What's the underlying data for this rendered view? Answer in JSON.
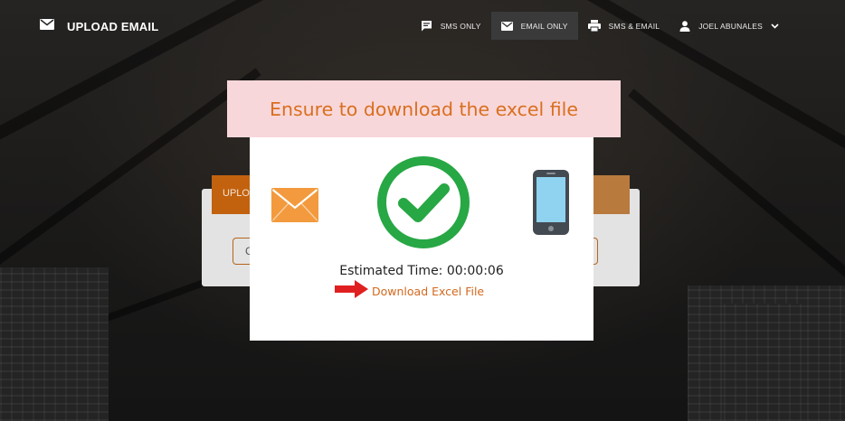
{
  "header": {
    "title": "UPLOAD EMAIL",
    "title_icon": "envelope-icon"
  },
  "nav": {
    "items": [
      {
        "label": "SMS ONLY",
        "icon": "sms-icon"
      },
      {
        "label": "EMAIL ONLY",
        "icon": "envelope-icon",
        "active": true
      },
      {
        "label": "SMS & EMAIL",
        "icon": "printer-icon"
      },
      {
        "label": "JOEL ABUNALES",
        "icon": "user-icon",
        "dropdown": "chevron-down-icon"
      }
    ]
  },
  "background_card": {
    "tab_label": "UPLO",
    "button_label": "C"
  },
  "modal": {
    "alert_text": "Ensure to download the excel file",
    "estimated_time": "Estimated Time: 00:00:06",
    "download_label": "Download Excel File",
    "icons": [
      "envelope-icon",
      "check-circle-icon",
      "smartphone-icon",
      "arrow-right-icon"
    ]
  },
  "colors": {
    "accent_orange": "#d2691e",
    "alert_bg": "#f8d7da",
    "success_green": "#28a745",
    "envelope_orange": "#f29a3d",
    "arrow_red": "#e02020"
  }
}
